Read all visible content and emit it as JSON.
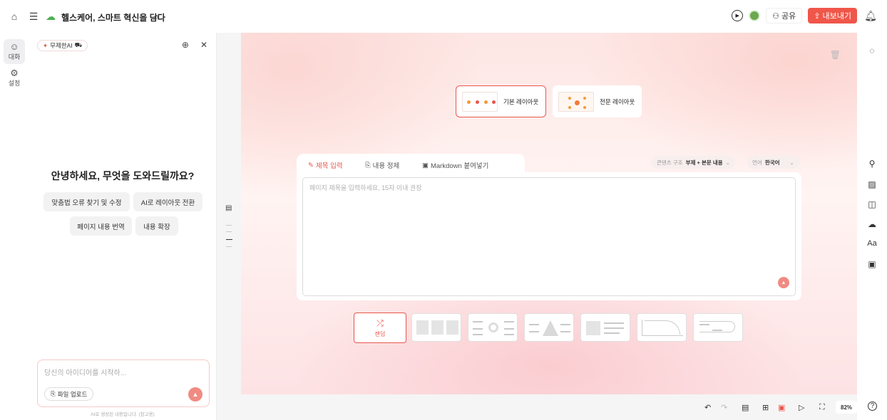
{
  "header": {
    "title": "헬스케어, 스마트 혁신을 담다",
    "share_label": "공유",
    "export_label": "내보내기"
  },
  "left_rail": {
    "items": [
      {
        "label": "대화",
        "icon": "chat-icon"
      },
      {
        "label": "설정",
        "icon": "gear-icon"
      }
    ]
  },
  "chat": {
    "ai_badge": "무제한AI",
    "greeting": "안녕하세요, 무엇을 도와드릴까요?",
    "suggestions": [
      "맞춤법 오류 찾기 및 수정",
      "AI로 레이아웃 전환",
      "페이지 내용 번역",
      "내용 확장"
    ],
    "input_placeholder": "당신의 아이디어를 시작하...",
    "upload_label": "파일 업로드",
    "disclaimer": "AI로 생성된 내용입니다. (참고용)"
  },
  "layouts": {
    "basic": "기본 레이아웃",
    "pro": "전문 레이아웃"
  },
  "editor": {
    "tabs": [
      "제목 입력",
      "내용 정제",
      "Markdown 붙여넣기"
    ],
    "content_structure_label": "콘텐츠 구조",
    "content_structure_value": "부제 + 본문 내용",
    "language_label": "언어",
    "language_value": "한국어",
    "title_placeholder": "페이지 제목을 입력하세요, 15자 이내 권장"
  },
  "templates": {
    "random_label": "랜덤"
  },
  "toolbar": {
    "zoom": "82%",
    "help": "?"
  },
  "colors": {
    "accent": "#e8564c",
    "accent_light": "#f08b83"
  }
}
